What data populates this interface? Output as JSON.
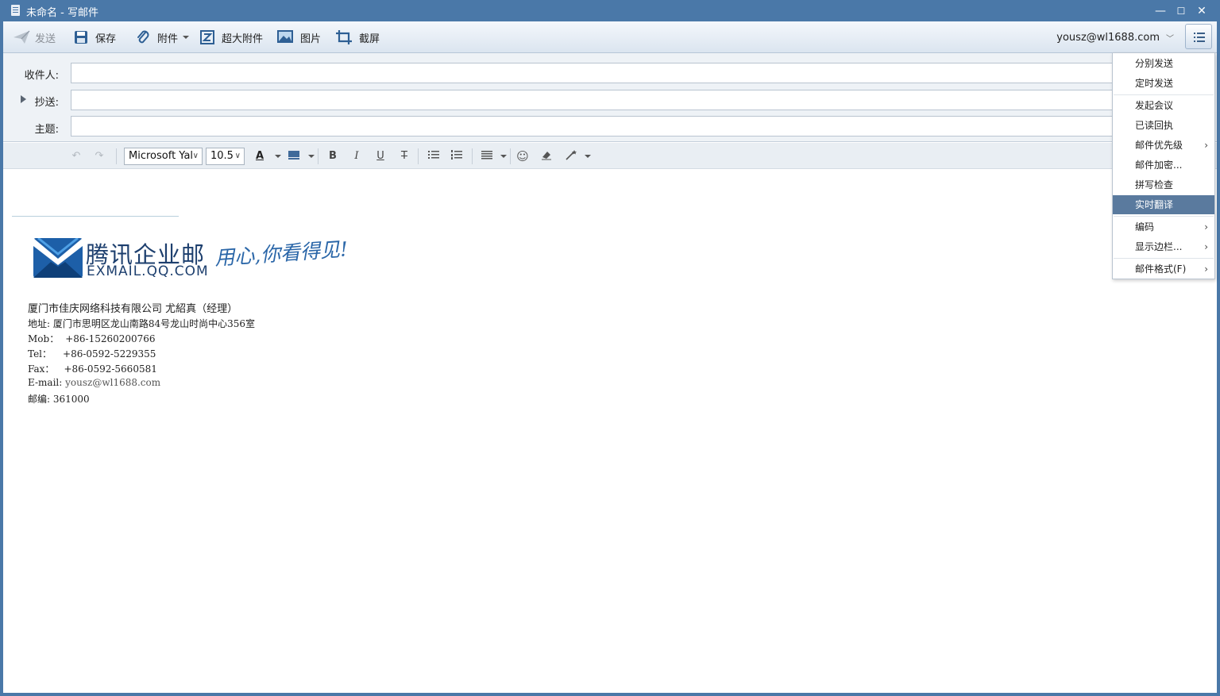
{
  "window": {
    "title": "未命名 - 写邮件",
    "minimize": "—",
    "maximize": "☐",
    "close": "✕"
  },
  "toolbar": {
    "send": "发送",
    "save": "保存",
    "attach": "附件",
    "big_attach": "超大附件",
    "image": "图片",
    "screenshot": "截屏",
    "account": "yousz@wl1688.com"
  },
  "fields": {
    "to_label": "收件人:",
    "cc_label": "抄送:",
    "subject_label": "主题:"
  },
  "editor_toolbar": {
    "font_family": "Microsoft Yal",
    "font_size": "10.5"
  },
  "signature": {
    "logo_brand": "腾讯企业邮",
    "logo_domain": "EXMAIL.QQ.COM",
    "logo_slogan": "用心,你看得见!",
    "company_line": "厦门市佳庆网络科技有限公司 尤紹真（经理）",
    "address": "地址: 厦门市思明区龙山南路84号龙山时尚中心356室",
    "mob_label": "Mob：",
    "mob": "+86-15260200766",
    "tel_label": "Tel：",
    "tel": "+86-0592-5229355",
    "fax_label": "Fax：",
    "fax": "+86-0592-5660581",
    "email_label": "E-mail:",
    "email": "yousz@wl1688.com",
    "zip_label": "邮编:",
    "zip": "361000"
  },
  "menu": {
    "items": [
      {
        "label": "分别发送"
      },
      {
        "label": "定时发送"
      },
      {
        "label": "发起会议"
      },
      {
        "label": "已读回执"
      },
      {
        "label": "邮件优先级"
      },
      {
        "label": "邮件加密..."
      },
      {
        "label": "拼写检查"
      },
      {
        "label": "实时翻译"
      },
      {
        "label": "编码"
      },
      {
        "label": "显示边栏..."
      },
      {
        "label": "邮件格式(F)"
      }
    ],
    "submenu_glyph": "›",
    "active_item": "实时翻译"
  },
  "colors": {
    "titlebar": "#4a78a8",
    "menu_active": "#5a7a9e",
    "logo_blue": "#1d3f6e",
    "slogan_blue": "#2a66a8"
  }
}
